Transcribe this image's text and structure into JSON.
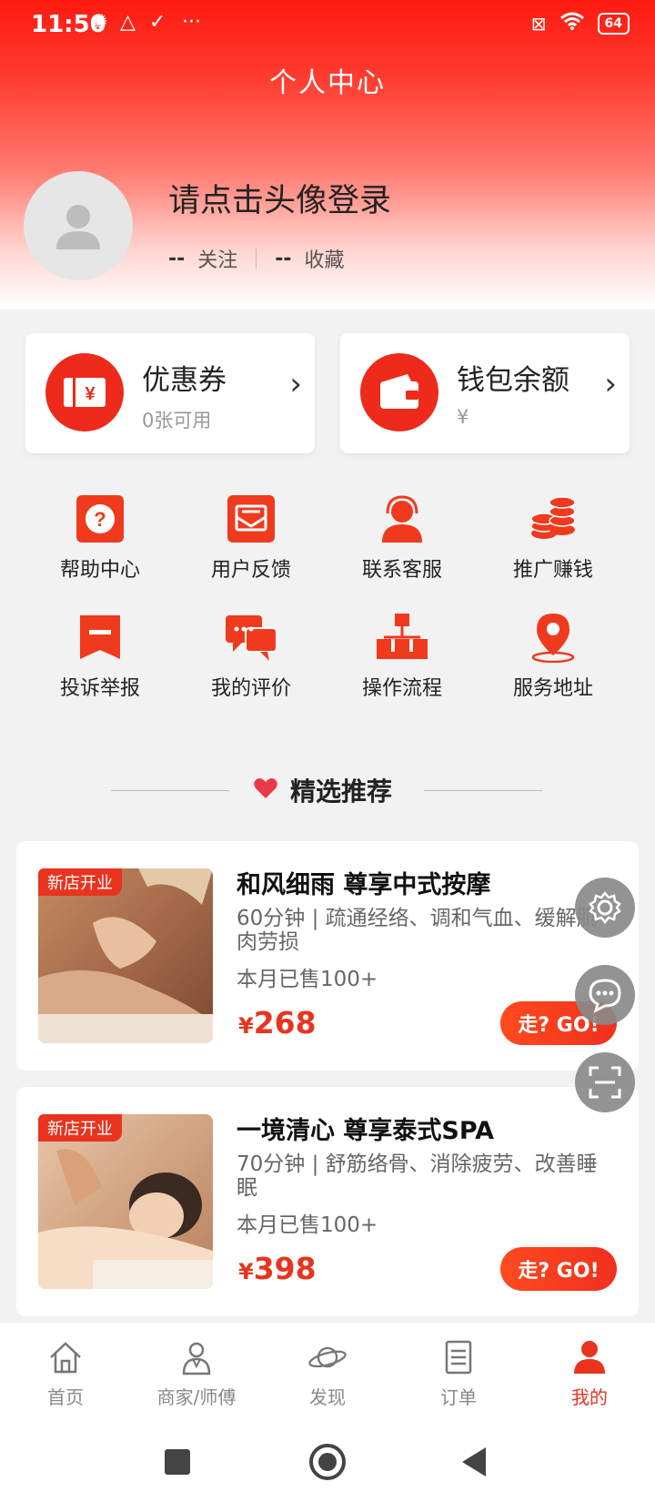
{
  "status_bar": {
    "time": "11:50",
    "battery": "64"
  },
  "header": {
    "title": "个人中心"
  },
  "profile": {
    "login_text": "请点击头像登录",
    "follow_count": "--",
    "follow_label": "关注",
    "favorite_count": "--",
    "favorite_label": "收藏"
  },
  "cards": [
    {
      "title": "优惠券",
      "sub": "0张可用",
      "icon": "coupon-icon"
    },
    {
      "title": "钱包余额",
      "sub": "¥",
      "icon": "wallet-icon"
    }
  ],
  "grid": [
    {
      "label": "帮助中心",
      "icon": "help-icon"
    },
    {
      "label": "用户反馈",
      "icon": "feedback-icon"
    },
    {
      "label": "联系客服",
      "icon": "customer-service-icon"
    },
    {
      "label": "推广赚钱",
      "icon": "coins-icon"
    },
    {
      "label": "投诉举报",
      "icon": "report-icon"
    },
    {
      "label": "我的评价",
      "icon": "comment-icon"
    },
    {
      "label": "操作流程",
      "icon": "flowchart-icon"
    },
    {
      "label": "服务地址",
      "icon": "location-icon"
    }
  ],
  "section": {
    "title": "精选推荐"
  },
  "products": [
    {
      "badge": "新店开业",
      "name": "和风细雨 尊享中式按摩",
      "desc": "60分钟 | 疏通经络、调和气血、缓解肌肉劳损",
      "sold": "本月已售100+",
      "currency": "¥",
      "price": "268",
      "go": "走? GO!"
    },
    {
      "badge": "新店开业",
      "name": "一境清心 尊享泰式SPA",
      "desc": "70分钟 | 舒筋络骨、消除疲劳、改善睡眠",
      "sold": "本月已售100+",
      "currency": "¥",
      "price": "398",
      "go": "走? GO!"
    }
  ],
  "tabs": [
    {
      "label": "首页",
      "icon": "home-icon"
    },
    {
      "label": "商家/师傅",
      "icon": "merchant-icon"
    },
    {
      "label": "发现",
      "icon": "planet-icon"
    },
    {
      "label": "订单",
      "icon": "order-icon"
    },
    {
      "label": "我的",
      "icon": "user-icon",
      "active": true
    }
  ],
  "colors": {
    "accent": "#e8341f",
    "header_top": "#ff1a10"
  }
}
